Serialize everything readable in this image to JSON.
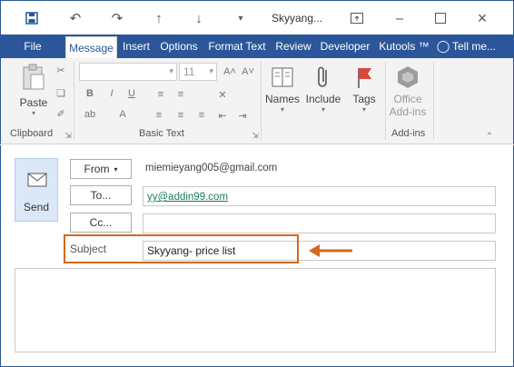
{
  "window": {
    "title": "Skyyang...",
    "colors": {
      "accent": "#2b579a",
      "highlight": "#d1691e",
      "send_bg": "#dbe8f7",
      "link": "#1e7a5f"
    }
  },
  "titlebar": {
    "icons": [
      "save-icon",
      "undo-icon",
      "redo-icon",
      "up-arrow-icon",
      "down-arrow-icon",
      "customize-icon",
      "restore-icon",
      "minimize-icon",
      "maximize-icon",
      "close-icon"
    ]
  },
  "tabs": [
    {
      "label": "File"
    },
    {
      "label": "Message"
    },
    {
      "label": "Insert"
    },
    {
      "label": "Options"
    },
    {
      "label": "Format Text"
    },
    {
      "label": "Review"
    },
    {
      "label": "Developer"
    },
    {
      "label": "Kutools ™"
    },
    {
      "label": "Tell me..."
    }
  ],
  "ribbon": {
    "clipboard": {
      "paste_label": "Paste",
      "group_label": "Clipboard"
    },
    "basic_text": {
      "font_size": "11",
      "group_label": "Basic Text",
      "bold": "B",
      "italic": "I",
      "underline": "U"
    },
    "names": {
      "label": "Names"
    },
    "include": {
      "label": "Include"
    },
    "tags": {
      "label": "Tags"
    },
    "addins": {
      "label_line1": "Office",
      "label_line2": "Add-ins",
      "group_label": "Add-ins"
    }
  },
  "compose": {
    "send_label": "Send",
    "from_label": "From",
    "from_value": "miemieyang005@gmail.com",
    "to_label": "To...",
    "to_value": "yy@addin99.com",
    "cc_label": "Cc...",
    "cc_value": "",
    "subject_label": "Subject",
    "subject_value": "Skyyang- price list",
    "body_value": ""
  }
}
